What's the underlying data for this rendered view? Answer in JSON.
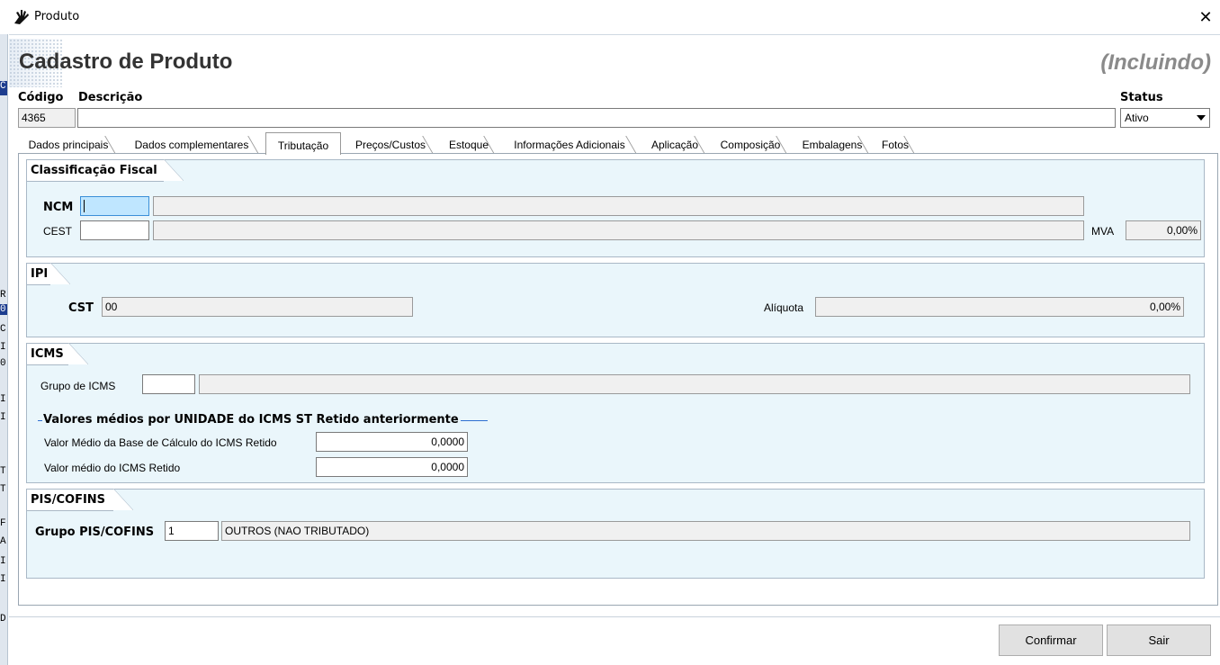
{
  "window": {
    "title": "Produto",
    "close_glyph": "✕"
  },
  "header": {
    "title": "Cadastro de Produto",
    "mode": "(Incluindo)"
  },
  "form": {
    "codigo_label": "Código",
    "codigo_value": "4365",
    "descricao_label": "Descrição",
    "descricao_value": "",
    "status_label": "Status",
    "status_value": "Ativo"
  },
  "tabs": [
    {
      "label": "Dados principais",
      "active": false
    },
    {
      "label": "Dados complementares",
      "active": false
    },
    {
      "label": "Tributação",
      "active": true
    },
    {
      "label": "Preços/Custos",
      "active": false
    },
    {
      "label": "Estoque",
      "active": false
    },
    {
      "label": "Informações Adicionais",
      "active": false
    },
    {
      "label": "Aplicação",
      "active": false
    },
    {
      "label": "Composição",
      "active": false
    },
    {
      "label": "Embalagens",
      "active": false
    },
    {
      "label": "Fotos",
      "active": false
    }
  ],
  "classificacao": {
    "title": "Classificação Fiscal",
    "ncm_label": "NCM",
    "ncm_value": "",
    "ncm_desc": "",
    "cest_label": "CEST",
    "cest_value": "",
    "cest_desc": "",
    "mva_label": "MVA",
    "mva_value": "0,00%"
  },
  "ipi": {
    "title": "IPI",
    "cst_label": "CST",
    "cst_value": "00",
    "aliquota_label": "Alíquota",
    "aliquota_value": "0,00%"
  },
  "icms": {
    "title": "ICMS",
    "grupo_label": "Grupo de ICMS",
    "grupo_value": "",
    "grupo_desc": "",
    "subhead": "Valores médios por UNIDADE do ICMS ST Retido anteriormente",
    "base_label": "Valor Médio da Base de Cálculo do ICMS Retido",
    "base_value": "0,0000",
    "valor_label": "Valor médio do ICMS Retido",
    "valor_value": "0,0000"
  },
  "pis": {
    "title": "PIS/COFINS",
    "grupo_label": "Grupo PIS/COFINS",
    "grupo_value": "1",
    "grupo_desc": "OUTROS (NAO TRIBUTADO)"
  },
  "footer": {
    "confirm_label": "Confirmar",
    "exit_label": "Sair"
  },
  "background_glyphs": [
    "C",
    "R",
    "0",
    "C",
    "I",
    "0",
    "I",
    "I",
    "T",
    "T",
    "F",
    "A",
    "I",
    "I",
    "D"
  ],
  "colors": {
    "focus_field": "#bfe6ff",
    "group_bg": "#eaf6fb",
    "subhead_line": "#2e6fd1"
  }
}
